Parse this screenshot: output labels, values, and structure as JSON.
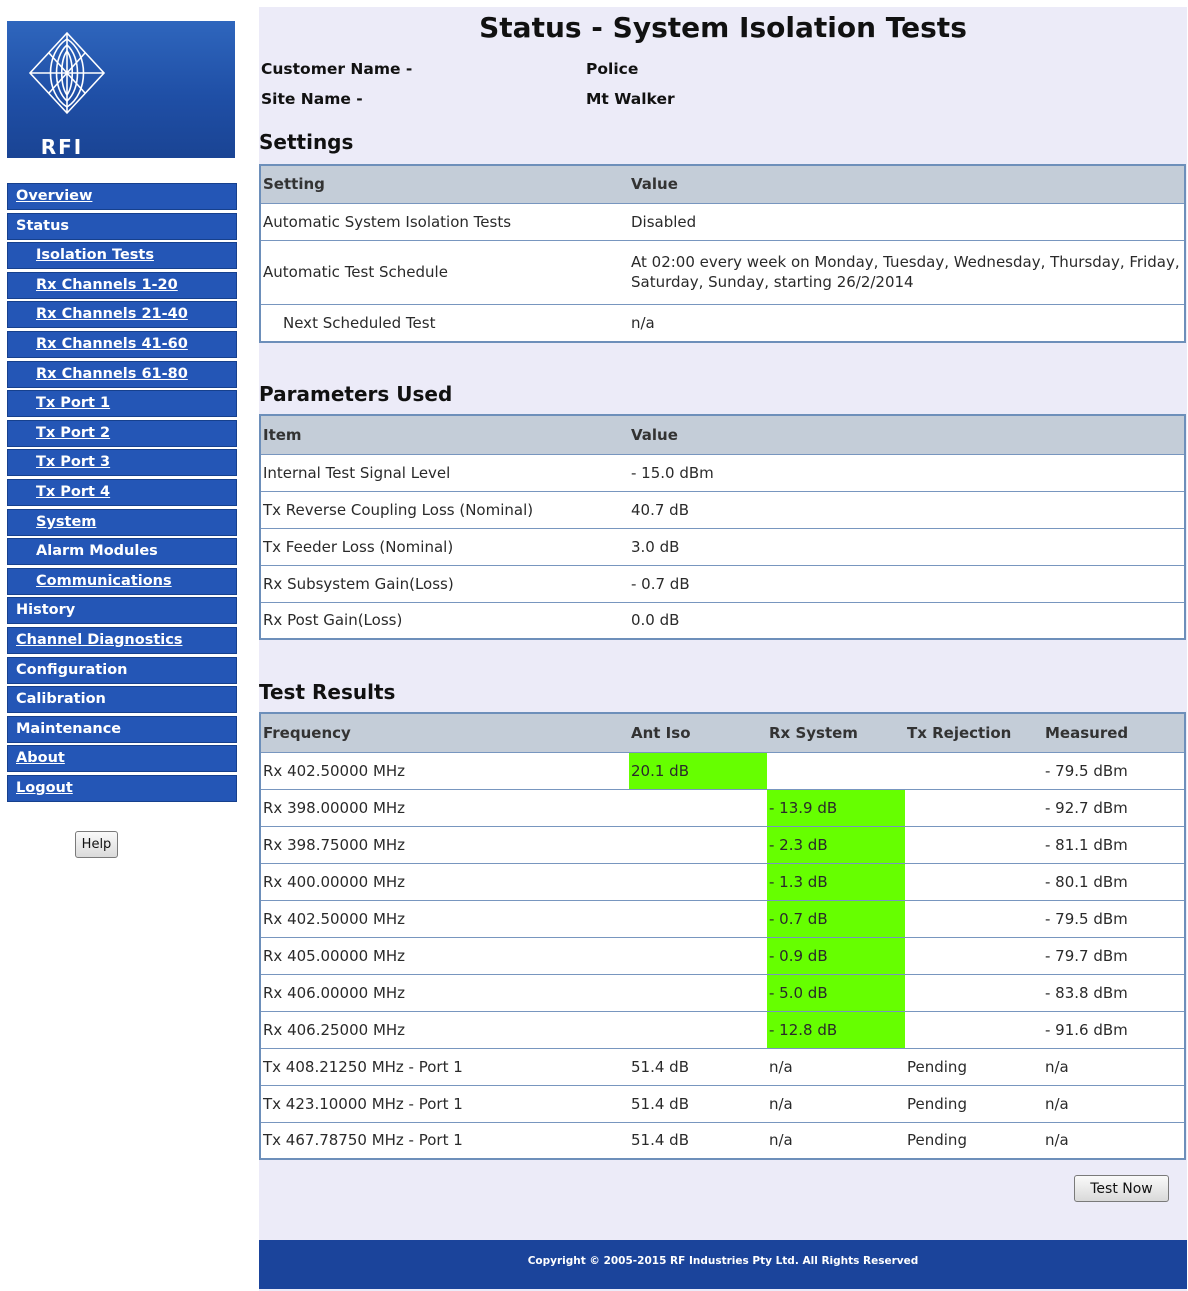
{
  "logo": {
    "text": "RFI"
  },
  "sidebar": {
    "items": [
      {
        "label": "Overview",
        "link": true,
        "sub": false
      },
      {
        "label": "Status",
        "link": false,
        "sub": false
      },
      {
        "label": "Isolation Tests",
        "link": true,
        "sub": true
      },
      {
        "label": "Rx Channels 1-20",
        "link": true,
        "sub": true
      },
      {
        "label": "Rx Channels 21-40",
        "link": true,
        "sub": true
      },
      {
        "label": "Rx Channels 41-60",
        "link": true,
        "sub": true
      },
      {
        "label": "Rx Channels 61-80",
        "link": true,
        "sub": true
      },
      {
        "label": "Tx Port 1",
        "link": true,
        "sub": true
      },
      {
        "label": "Tx Port 2",
        "link": true,
        "sub": true
      },
      {
        "label": "Tx Port 3",
        "link": true,
        "sub": true
      },
      {
        "label": "Tx Port 4",
        "link": true,
        "sub": true
      },
      {
        "label": "System",
        "link": true,
        "sub": true
      },
      {
        "label": "Alarm Modules",
        "link": false,
        "sub": true
      },
      {
        "label": "Communications",
        "link": true,
        "sub": true
      },
      {
        "label": "History",
        "link": false,
        "sub": false
      },
      {
        "label": "Channel Diagnostics",
        "link": true,
        "sub": false
      },
      {
        "label": "Configuration",
        "link": false,
        "sub": false
      },
      {
        "label": "Calibration",
        "link": false,
        "sub": false
      },
      {
        "label": "Maintenance",
        "link": false,
        "sub": false
      },
      {
        "label": "About",
        "link": true,
        "sub": false
      },
      {
        "label": "Logout",
        "link": true,
        "sub": false
      }
    ],
    "help_label": "Help"
  },
  "page": {
    "title": "Status - System Isolation Tests",
    "customer_label": "Customer Name -",
    "customer_value": "Police",
    "site_label": "Site Name -",
    "site_value": "Mt Walker"
  },
  "settings": {
    "title": "Settings",
    "headers": [
      "Setting",
      "Value"
    ],
    "rows": [
      {
        "setting": "Automatic System Isolation Tests",
        "value": "Disabled",
        "indent": false
      },
      {
        "setting": "Automatic Test Schedule",
        "value": "At 02:00 every week on Monday, Tuesday, Wednesday, Thursday, Friday, Saturday, Sunday, starting 26/2/2014",
        "indent": false
      },
      {
        "setting": "Next Scheduled Test",
        "value": "n/a",
        "indent": true
      }
    ]
  },
  "parameters": {
    "title": "Parameters Used",
    "headers": [
      "Item",
      "Value"
    ],
    "rows": [
      {
        "item": "Internal Test Signal Level",
        "value": "- 15.0 dBm"
      },
      {
        "item": "Tx Reverse Coupling Loss (Nominal)",
        "value": "40.7 dB"
      },
      {
        "item": "Tx Feeder Loss (Nominal)",
        "value": "3.0 dB"
      },
      {
        "item": "Rx Subsystem Gain(Loss)",
        "value": "- 0.7 dB"
      },
      {
        "item": "Rx Post Gain(Loss)",
        "value": "0.0 dB"
      }
    ]
  },
  "results": {
    "title": "Test Results",
    "headers": [
      "Frequency",
      "Ant Iso",
      "Rx System",
      "Tx Rejection",
      "Measured"
    ],
    "rows": [
      {
        "frequency": "Rx 402.50000 MHz",
        "ant_iso": "20.1 dB",
        "rx_system": "",
        "tx_rejection": "",
        "measured": "- 79.5 dBm",
        "ant_iso_ok": true,
        "rx_system_ok": false
      },
      {
        "frequency": "Rx 398.00000 MHz",
        "ant_iso": "",
        "rx_system": "- 13.9 dB",
        "tx_rejection": "",
        "measured": "- 92.7 dBm",
        "ant_iso_ok": false,
        "rx_system_ok": true
      },
      {
        "frequency": "Rx 398.75000 MHz",
        "ant_iso": "",
        "rx_system": "- 2.3 dB",
        "tx_rejection": "",
        "measured": "- 81.1 dBm",
        "ant_iso_ok": false,
        "rx_system_ok": true
      },
      {
        "frequency": "Rx 400.00000 MHz",
        "ant_iso": "",
        "rx_system": "- 1.3 dB",
        "tx_rejection": "",
        "measured": "- 80.1 dBm",
        "ant_iso_ok": false,
        "rx_system_ok": true
      },
      {
        "frequency": "Rx 402.50000 MHz",
        "ant_iso": "",
        "rx_system": "- 0.7 dB",
        "tx_rejection": "",
        "measured": "- 79.5 dBm",
        "ant_iso_ok": false,
        "rx_system_ok": true
      },
      {
        "frequency": "Rx 405.00000 MHz",
        "ant_iso": "",
        "rx_system": "- 0.9 dB",
        "tx_rejection": "",
        "measured": "- 79.7 dBm",
        "ant_iso_ok": false,
        "rx_system_ok": true
      },
      {
        "frequency": "Rx 406.00000 MHz",
        "ant_iso": "",
        "rx_system": "- 5.0 dB",
        "tx_rejection": "",
        "measured": "- 83.8 dBm",
        "ant_iso_ok": false,
        "rx_system_ok": true
      },
      {
        "frequency": "Rx 406.25000 MHz",
        "ant_iso": "",
        "rx_system": "- 12.8 dB",
        "tx_rejection": "",
        "measured": "- 91.6 dBm",
        "ant_iso_ok": false,
        "rx_system_ok": true
      },
      {
        "frequency": "Tx 408.21250 MHz - Port 1",
        "ant_iso": "51.4 dB",
        "rx_system": "n/a",
        "tx_rejection": "Pending",
        "measured": "n/a",
        "ant_iso_ok": false,
        "rx_system_ok": false
      },
      {
        "frequency": "Tx 423.10000 MHz - Port 1",
        "ant_iso": "51.4 dB",
        "rx_system": "n/a",
        "tx_rejection": "Pending",
        "measured": "n/a",
        "ant_iso_ok": false,
        "rx_system_ok": false
      },
      {
        "frequency": "Tx 467.78750 MHz - Port 1",
        "ant_iso": "51.4 dB",
        "rx_system": "n/a",
        "tx_rejection": "Pending",
        "measured": "n/a",
        "ant_iso_ok": false,
        "rx_system_ok": false
      }
    ],
    "test_now_label": "Test Now"
  },
  "footer": {
    "copyright": "Copyright © 2005-2015 RF Industries Pty Ltd. All Rights Reserved"
  },
  "colors": {
    "nav_bg": "#2456b6",
    "main_bg": "#ecebf8",
    "pass_green": "#66ff00",
    "footer_bg": "#1b449b"
  }
}
